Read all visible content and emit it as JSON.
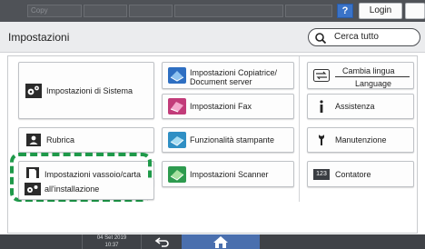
{
  "topbar": {
    "copy_label": "Copy",
    "help_label": "?",
    "login_label": "Login",
    "moon_icon": "moon-icon"
  },
  "header": {
    "title": "Impostazioni",
    "search_label": "Cerca tutto"
  },
  "tiles": {
    "system": "Impostazioni di Sistema",
    "copier_line1": "Impostazioni Copiatrice/",
    "copier_line2": "Document server",
    "fax": "Impostazioni Fax",
    "address_book": "Rubrica",
    "printer": "Funzionalità stampante",
    "tray_paper": "Impostazioni vassoio/carta",
    "scanner": "Impostazioni Scanner",
    "installation": "all'installazione",
    "language_line1": "Cambia lingua",
    "language_line2": "Language",
    "assistance": "Assistenza",
    "maintenance": "Manutenzione",
    "counter": "Contatore",
    "counter_icon_text": "123"
  },
  "bottombar": {
    "date": "04 Set 2019",
    "time": "10:37"
  },
  "colors": {
    "highlight": "#1f9a4a",
    "topbar": "#4f5257",
    "home_button": "#4a6fae"
  }
}
